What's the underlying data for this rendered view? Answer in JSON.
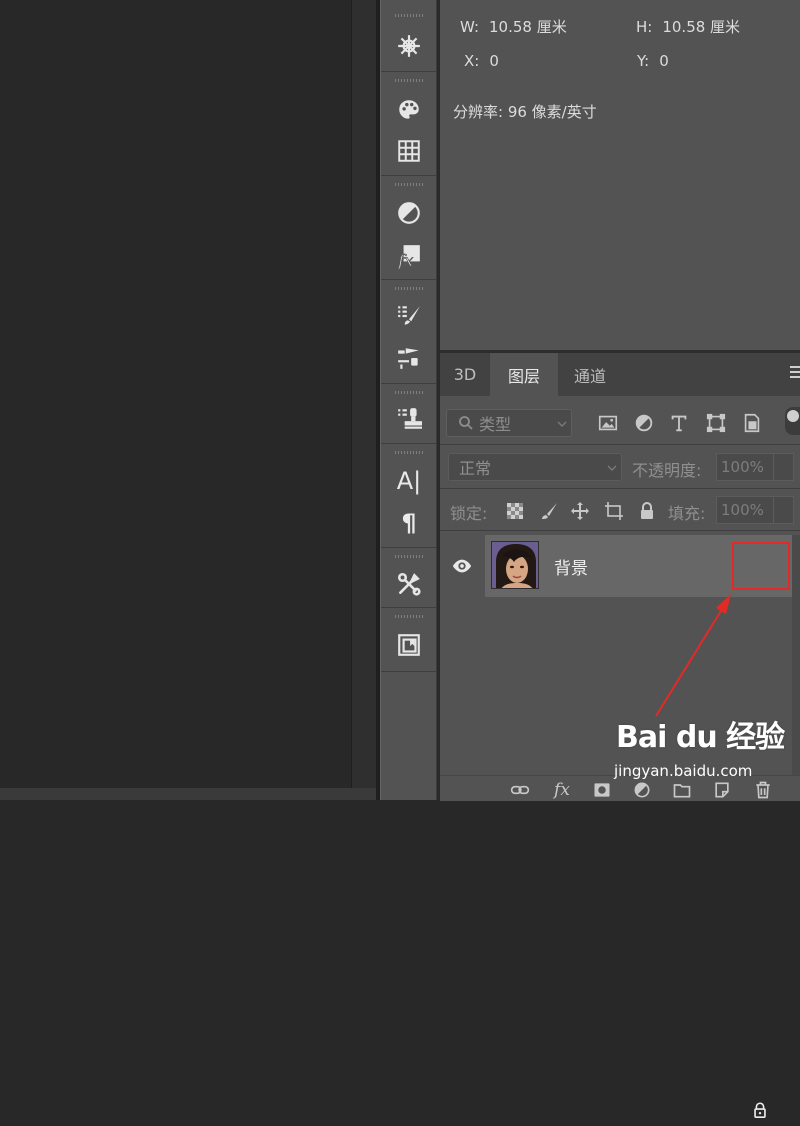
{
  "properties": {
    "width_label": "W:",
    "width_value": "10.58 厘米",
    "height_label": "H:",
    "height_value": "10.58 厘米",
    "x_label": "X:",
    "x_value": "0",
    "y_label": "Y:",
    "y_value": "0",
    "resolution": "分辨率: 96 像素/英寸"
  },
  "tabs": [
    {
      "label": "3D",
      "active": false
    },
    {
      "label": "图层",
      "active": true
    },
    {
      "label": "通道",
      "active": false
    }
  ],
  "filter": {
    "kind_placeholder": "类型",
    "icons": [
      "image-filter-icon",
      "adjustment-filter-icon",
      "type-filter-icon",
      "shape-filter-icon",
      "smart-object-filter-icon"
    ]
  },
  "blend": {
    "mode": "正常",
    "opacity_label": "不透明度:",
    "opacity_value": "100%",
    "lock_label": "锁定:",
    "fill_label": "填充:",
    "fill_value": "100%"
  },
  "layers": [
    {
      "name": "背景",
      "visible": true,
      "locked": true
    }
  ],
  "toolstrip": {
    "icons": [
      "ship-wheel-icon",
      "palette-icon",
      "grid-icon",
      "adjustment-icon",
      "fx-icon",
      "brush-list-icon",
      "brush-settings-icon",
      "clone-stamp-icon",
      "character-icon",
      "paragraph-icon",
      "tools-icon",
      "frame-icon"
    ],
    "character_glyph": "A|",
    "paragraph_glyph": "¶"
  },
  "footer": {
    "icons": [
      "link-icon",
      "fx-icon",
      "mask-icon",
      "adjustment-icon",
      "folder-icon",
      "new-layer-icon",
      "trash-icon"
    ],
    "fx_text": "fx"
  },
  "watermark": {
    "main": "Bai du 经验",
    "url": "jingyan.baidu.com"
  },
  "colors": {
    "panel_bg": "#535353",
    "canvas_bg": "#282828",
    "highlight": "#e42a26"
  }
}
